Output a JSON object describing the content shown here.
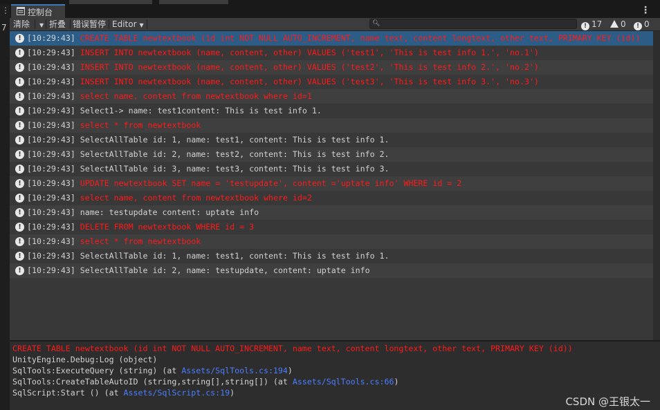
{
  "left_panel": {
    "number": "7"
  },
  "tab": {
    "label": "控制台"
  },
  "toolbar": {
    "clear_label": "清除",
    "collapse_label": "折叠",
    "error_pause_label": "错误暂停",
    "editor_label": "Editor",
    "search_placeholder": "",
    "counts": {
      "log": "17",
      "warning": "0",
      "error": "0"
    }
  },
  "logs": [
    {
      "time": "[10:29:43]",
      "message": "CREATE TABLE newtextbook (id int NOT NULL AUTO_INCREMENT, name text, content longtext, other text, PRIMARY KEY (id))",
      "color": "#ff1a1a",
      "selected": true
    },
    {
      "time": "[10:29:43]",
      "message": "INSERT INTO newtextbook (name, content, other) VALUES ('test1', 'This is test info 1.', 'no.1')",
      "color": "#ff1a1a"
    },
    {
      "time": "[10:29:43]",
      "message": "INSERT INTO newtextbook (name, content, other) VALUES ('test2', 'This is test info 2.', 'no.2')",
      "color": "#ff1a1a"
    },
    {
      "time": "[10:29:43]",
      "message": "INSERT INTO newtextbook (name, content, other) VALUES ('test3', 'This is test info 3.', 'no.3')",
      "color": "#ff1a1a"
    },
    {
      "time": "[10:29:43]",
      "message": "select name, content from newtextbook where id=1",
      "color": "#ff1a1a"
    },
    {
      "time": "[10:29:43]",
      "message": "Select1-> name: test1content:  This is test info 1.",
      "color": "#d2d2d2"
    },
    {
      "time": "[10:29:43]",
      "message": "select * from newtextbook",
      "color": "#ff1a1a"
    },
    {
      "time": "[10:29:43]",
      "message": "SelectAllTable id: 1, name:  test1, content:  This is test info 1.",
      "color": "#d2d2d2"
    },
    {
      "time": "[10:29:43]",
      "message": "SelectAllTable id: 2, name:  test2, content:  This is test info 2.",
      "color": "#d2d2d2"
    },
    {
      "time": "[10:29:43]",
      "message": "SelectAllTable id: 3, name:  test3, content:  This is test info 3.",
      "color": "#d2d2d2"
    },
    {
      "time": "[10:29:43]",
      "message": "UPDATE newtextbook SET name = 'testupdate', content ='uptate info' WHERE id = 2",
      "color": "#ff1a1a"
    },
    {
      "time": "[10:29:43]",
      "message": "select name, content from newtextbook where id=2",
      "color": "#ff1a1a"
    },
    {
      "time": "[10:29:43]",
      "message": "name: testupdate   content:  uptate info",
      "color": "#d2d2d2"
    },
    {
      "time": "[10:29:43]",
      "message": "DELETE FROM newtextbook WHERE id = 3",
      "color": "#ff1a1a"
    },
    {
      "time": "[10:29:43]",
      "message": "select * from newtextbook",
      "color": "#ff1a1a"
    },
    {
      "time": "[10:29:43]",
      "message": "SelectAllTable id: 1, name:  test1, content:  This is test info 1.",
      "color": "#d2d2d2"
    },
    {
      "time": "[10:29:43]",
      "message": "SelectAllTable id: 2, name:  testupdate, content:  uptate info",
      "color": "#d2d2d2"
    }
  ],
  "detail": {
    "message": "CREATE TABLE newtextbook (id int NOT NULL AUTO_INCREMENT, name text, content longtext, other text, PRIMARY KEY (id))",
    "stack": [
      {
        "text": "UnityEngine.Debug:Log (object)",
        "link": "",
        "suffix": ""
      },
      {
        "text": "SqlTools:ExecuteQuery (string) (at ",
        "link": "Assets/SqlTools.cs:194",
        "suffix": ")"
      },
      {
        "text": "SqlTools:CreateTableAutoID (string,string[],string[]) (at ",
        "link": "Assets/SqlTools.cs:66",
        "suffix": ")"
      },
      {
        "text": "SqlScript:Start () (at ",
        "link": "Assets/SqlScript.cs:19",
        "suffix": ")"
      }
    ]
  },
  "watermark": "CSDN @王银太一",
  "colors": {
    "selected_row": "#2c5d87",
    "error_text": "#ff1a1a",
    "link": "#4c7eff",
    "tab_accent": "#3a79bb"
  }
}
